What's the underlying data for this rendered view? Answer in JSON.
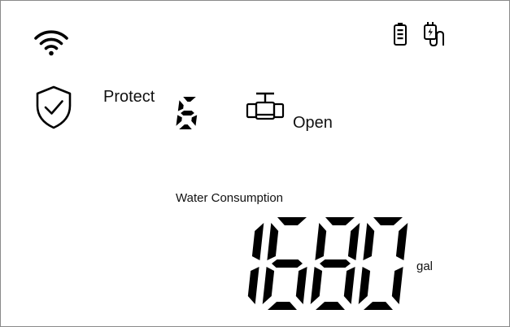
{
  "status": {
    "wifi_icon": "wifi-icon",
    "battery_icon": "battery-icon",
    "power_adapter_icon": "power-adapter-icon"
  },
  "protect": {
    "label": "Protect",
    "level": "6",
    "shield_icon": "shield-check-icon"
  },
  "valve": {
    "icon": "valve-icon",
    "state": "Open"
  },
  "consumption": {
    "label": "Water Consumption",
    "value": "1680",
    "unit": "gal"
  },
  "colors": {
    "background": "#ffffff",
    "border": "#8a8a8a",
    "foreground": "#000000"
  }
}
